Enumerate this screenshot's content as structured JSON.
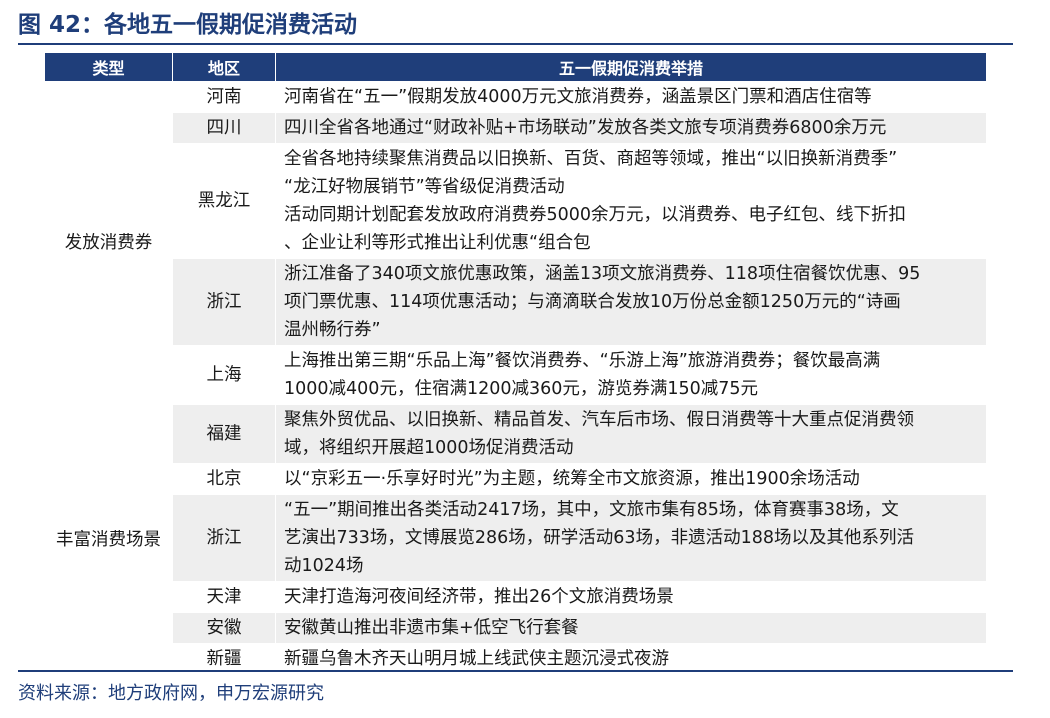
{
  "title": "图 42：各地五一假期促消费活动",
  "table": {
    "headers": [
      "类型",
      "地区",
      "五一假期促消费举措"
    ],
    "categories": [
      "发放消费券",
      "丰富消费场景"
    ],
    "rows": [
      {
        "region": "河南",
        "desc": "河南省在“五一”假期发放4000万元文旅消费券，涵盖景区门票和酒店住宿等"
      },
      {
        "region": "四川",
        "desc": "四川全省各地通过“财政补贴+市场联动”发放各类文旅专项消费券6800余万元"
      },
      {
        "region": "黑龙江",
        "desc": "全省各地持续聚焦消费品以旧换新、百货、商超等领域，推出“以旧换新消费季”\n“龙江好物展销节”等省级促消费活动\n活动同期计划配套发放政府消费券5000余万元，以消费券、电子红包、线下折扣\n、企业让利等形式推出让利优惠“组合包"
      },
      {
        "region": "浙江",
        "desc": "浙江准备了340项文旅优惠政策，涵盖13项文旅消费券、118项住宿餐饮优惠、95\n项门票优惠、114项优惠活动；与滴滴联合发放10万份总金额1250万元的“诗画\n温州畅行券”"
      },
      {
        "region": "上海",
        "desc": "上海推出第三期“乐品上海”餐饮消费券、“乐游上海”旅游消费券；餐饮最高满\n1000减400元，住宿满1200减360元，游览券满150减75元"
      },
      {
        "region": "福建",
        "desc": "聚焦外贸优品、以旧换新、精品首发、汽车后市场、假日消费等十大重点促消费领\n域，将组织开展超1000场促消费活动"
      },
      {
        "region": "北京",
        "desc": "以“京彩五一·乐享好时光”为主题，统筹全市文旅资源，推出1900余场活动"
      },
      {
        "region": "浙江",
        "desc": "“五一”期间推出各类活动2417场，其中，文旅市集有85场，体育赛事38场，文\n艺演出733场，文博展览286场，研学活动63场，非遗活动188场以及其他系列活\n动1024场"
      },
      {
        "region": "天津",
        "desc": "天津打造海河夜间经济带，推出26个文旅消费场景"
      },
      {
        "region": "安徽",
        "desc": "安徽黄山推出非遗市集+低空飞行套餐"
      },
      {
        "region": "新疆",
        "desc": "新疆乌鲁木齐天山明月城上线武侠主题沉浸式夜游"
      }
    ]
  },
  "source": "资料来源：地方政府网，申万宏源研究"
}
